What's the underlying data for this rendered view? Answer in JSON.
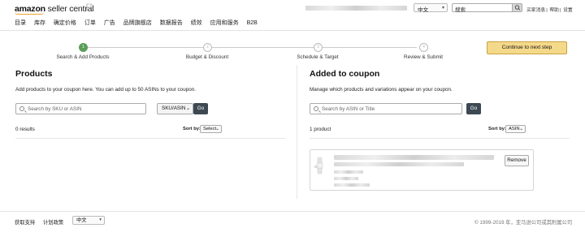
{
  "header": {
    "logo_bold": "amazon",
    "logo_rest": " seller central",
    "language": "中文",
    "search_placeholder": "搜索",
    "links": [
      "买家消息",
      "帮助",
      "设置"
    ],
    "separator": "|"
  },
  "nav": {
    "items": [
      "目录",
      "库存",
      "确定价格",
      "订单",
      "广告",
      "品牌旗舰店",
      "数据报告",
      "绩效",
      "应用和服务",
      "B2B"
    ]
  },
  "steps": {
    "items": [
      {
        "label": "Search & Add Products",
        "num": "1"
      },
      {
        "label": "Budget & Discount",
        "num": "2"
      },
      {
        "label": "Schedule & Target",
        "num": "3"
      },
      {
        "label": "Review & Submit",
        "num": "4"
      }
    ],
    "continue_label": "Continue to next step"
  },
  "products": {
    "title": "Products",
    "description": "Add products to your coupon here. You can add up to 50 ASINs to your coupon.",
    "search_placeholder": "Search by SKU or ASIN",
    "type_select": "SKU/ASIN",
    "go_label": "Go",
    "results": "0 results",
    "sort_label": "Sort by:",
    "sort_value": "Select"
  },
  "coupon": {
    "title": "Added to coupon",
    "description": "Manage which products and variations appear on your coupon.",
    "search_placeholder": "Search by ASIN or Title",
    "go_label": "Go",
    "count": "1 product",
    "sort_label": "Sort by:",
    "sort_value": "ASIN",
    "remove_label": "Remove"
  },
  "footer": {
    "links": [
      "获取支持",
      "计划政策"
    ],
    "language": "中文",
    "copyright": "© 1999-2019 年，亚马逊公司或其附属公司"
  },
  "colors": {
    "active_step": "#5a9e5a",
    "continue_button": "#f5d98a",
    "go_button": "#3d4853",
    "logo_smile": "#f0a030"
  }
}
